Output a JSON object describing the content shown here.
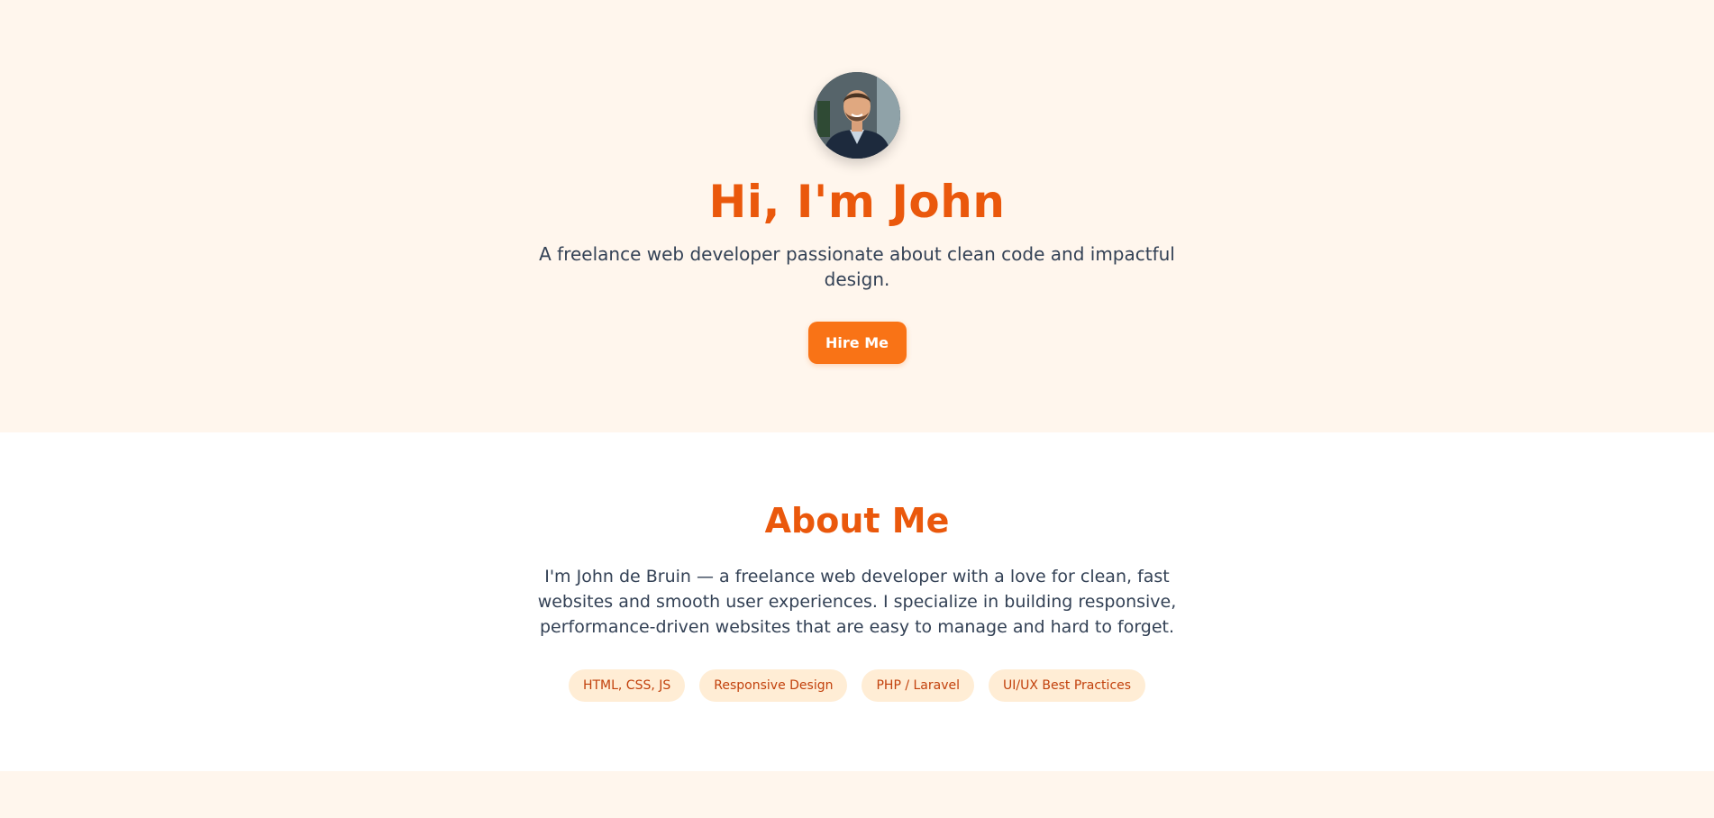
{
  "hero": {
    "title": "Hi, I'm John",
    "tagline": "A freelance web developer passionate about clean code and impactful design.",
    "hire_label": "Hire Me"
  },
  "about": {
    "title": "About Me",
    "text": "I'm John de Bruin — a freelance web developer with a love for clean, fast websites and smooth user experiences. I specialize in building responsive, performance-driven websites that are easy to manage and hard to forget.",
    "skills": [
      "HTML, CSS, JS",
      "Responsive Design",
      "PHP / Laravel",
      "UI/UX Best Practices"
    ]
  },
  "colors": {
    "accent": "#ea580c",
    "button": "#f97316",
    "hero_background": "#fff6ed",
    "tag_background": "#ffedd5",
    "tag_text": "#c2410c",
    "body_text": "#334155"
  }
}
